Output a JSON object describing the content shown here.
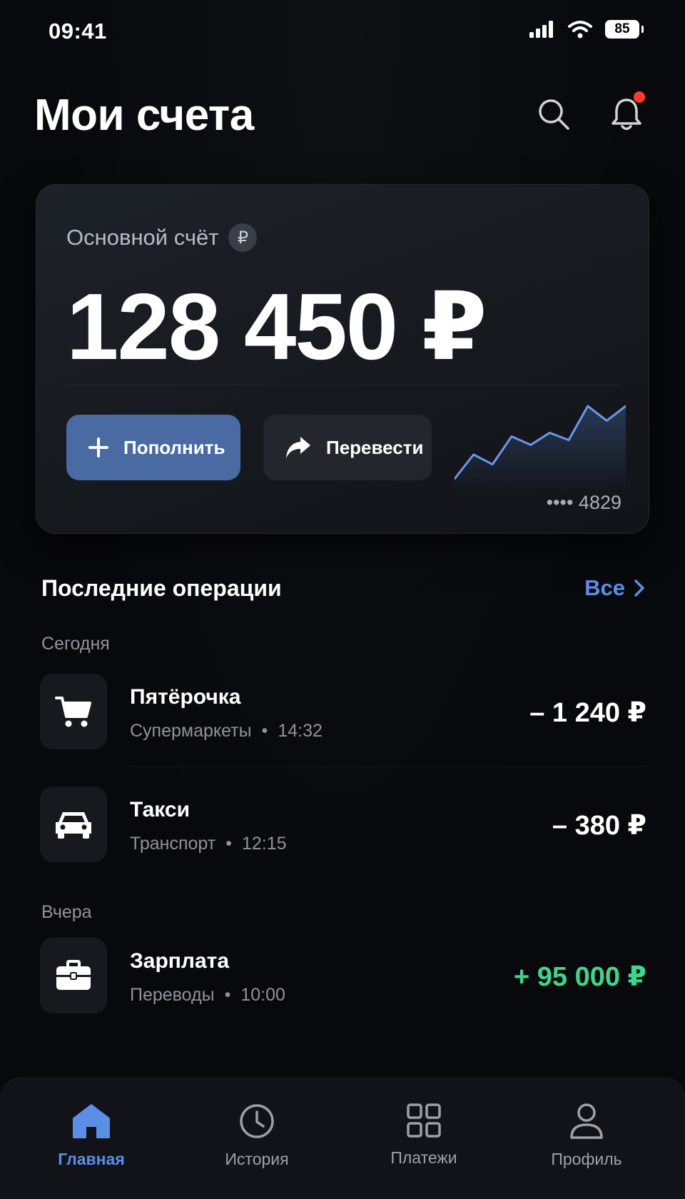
{
  "status_bar": {
    "time": "09:41",
    "battery": "85"
  },
  "header": {
    "title": "Мои счета",
    "search_icon": "search-icon",
    "notifications_icon": "bell-icon",
    "notification_badge": true
  },
  "account": {
    "label": "Основной счёт",
    "currency_symbol": "₽",
    "balance": "128 450 ₽",
    "topup_label": "Пополнить",
    "transfer_label": "Перевести",
    "card_number": "•••• 4829",
    "sparkline_values": [
      2,
      4,
      3.2,
      5.5,
      4.8,
      5.8,
      5.2,
      8,
      6.8,
      8
    ]
  },
  "recent": {
    "title": "Последние операции",
    "see_all": "Все",
    "groups": [
      {
        "day": "Сегодня",
        "items": [
          {
            "name": "Пятёрочка",
            "category": "Супермаркеты",
            "time": "14:32",
            "amount": "– 1 240 ₽",
            "icon": "cart-icon"
          },
          {
            "name": "Такси",
            "category": "Транспорт",
            "time": "12:15",
            "amount": "– 380 ₽",
            "icon": "car-icon"
          }
        ]
      },
      {
        "day": "Вчера",
        "items": [
          {
            "name": "Зарплата",
            "category": "Переводы",
            "time": "10:00",
            "amount": "+ 95 000 ₽",
            "icon": "briefcase-icon"
          }
        ]
      }
    ]
  },
  "nav": {
    "items": [
      {
        "label": "Главная",
        "icon": "home-icon",
        "active": true
      },
      {
        "label": "История",
        "icon": "clock-icon",
        "active": false
      },
      {
        "label": "Платежи",
        "icon": "grid-icon",
        "active": false
      },
      {
        "label": "Профиль",
        "icon": "user-icon",
        "active": false
      }
    ]
  },
  "colors": {
    "accent": "#5b8ee6",
    "income": "#3ed68a",
    "topup_button": "#4a6aa3",
    "notification": "#ff3b30"
  }
}
